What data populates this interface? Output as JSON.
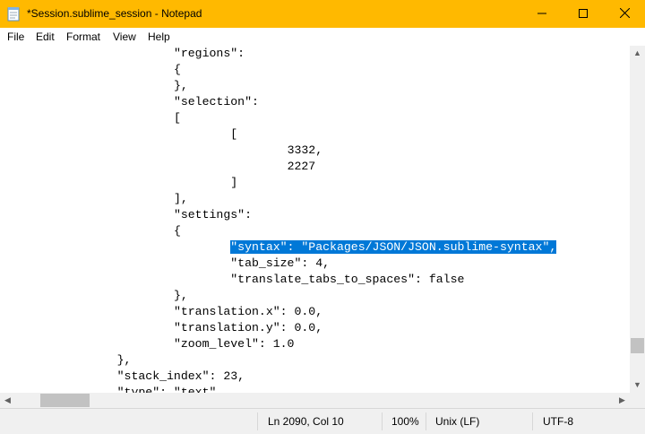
{
  "window": {
    "title": "*Session.sublime_session - Notepad",
    "icons": {
      "app": "notepad-icon",
      "minimize": "minimize-icon",
      "maximize": "maximize-icon",
      "close": "close-icon"
    },
    "colors": {
      "titlebar": "#ffb900",
      "selection": "#0078d7"
    }
  },
  "menu": {
    "file": "File",
    "edit": "Edit",
    "format": "Format",
    "view": "View",
    "help": "Help"
  },
  "editor": {
    "lines": [
      "\t\t\t\"regions\":",
      "\t\t\t{",
      "\t\t\t},",
      "\t\t\t\"selection\":",
      "\t\t\t[",
      "\t\t\t\t[",
      "\t\t\t\t\t3332,",
      "\t\t\t\t\t2227",
      "\t\t\t\t]",
      "\t\t\t],",
      "\t\t\t\"settings\":",
      "\t\t\t{",
      "__SELECTED__",
      "\t\t\t\t\"tab_size\": 4,",
      "\t\t\t\t\"translate_tabs_to_spaces\": false",
      "\t\t\t},",
      "\t\t\t\"translation.x\": 0.0,",
      "\t\t\t\"translation.y\": 0.0,",
      "\t\t\t\"zoom_level\": 1.0",
      "\t\t},",
      "\t\t\"stack_index\": 23,",
      "\t\t\"type\": \"text\""
    ],
    "selected_line_indent": "\t\t\t\t",
    "selected_text": "\"syntax\": \"Packages/JSON/JSON.sublime-syntax\","
  },
  "status": {
    "position": "Ln 2090, Col 10",
    "zoom": "100%",
    "line_ending": "Unix (LF)",
    "encoding": "UTF-8"
  },
  "scrollbars": {
    "vertical_arrows": {
      "up": "up-arrow-icon",
      "down": "down-arrow-icon"
    },
    "horizontal_arrows": {
      "left": "left-arrow-icon",
      "right": "right-arrow-icon"
    }
  }
}
